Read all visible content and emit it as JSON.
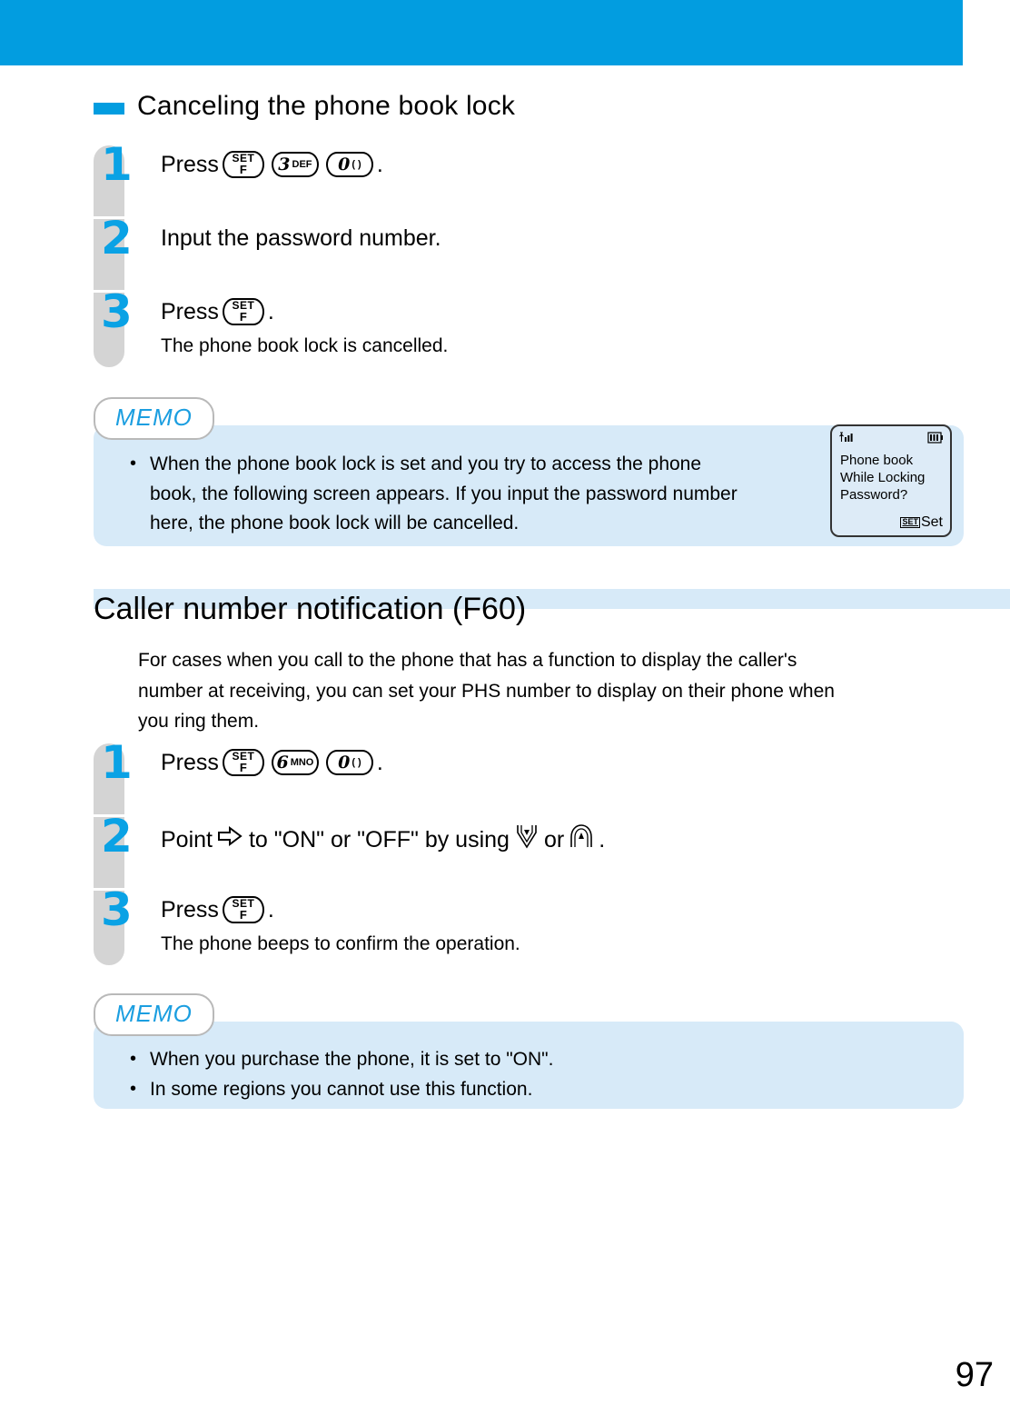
{
  "page": {
    "number": "97",
    "banner_color": "#029de0",
    "accent_color": "#0aa2e5",
    "memo_bg_color": "#d7eaf8"
  },
  "subsection": {
    "title": "Canceling the phone book lock",
    "steps": [
      {
        "number": "1",
        "text_before": "Press",
        "keys": [
          "SET/F",
          "3 DEF",
          "0 ( )"
        ],
        "text_after": ".",
        "sub": ""
      },
      {
        "number": "2",
        "text_before": "Input the password number.",
        "keys": [],
        "text_after": "",
        "sub": ""
      },
      {
        "number": "3",
        "text_before": "Press",
        "keys": [
          "SET/F"
        ],
        "text_after": ".",
        "sub": "The phone book lock is cancelled."
      }
    ]
  },
  "memo1": {
    "label": "MEMO",
    "items": [
      {
        "bullet": "•",
        "lines": [
          "When the phone book lock is set and you try to access the phone",
          "book, the following screen appears. If you input the password number",
          "here, the phone book lock will be cancelled."
        ]
      }
    ],
    "phone_screen": {
      "signal_icon": "signal-bars-icon",
      "battery_icon": "battery-icon",
      "lines": [
        "Phone book",
        "While Locking",
        "Password?"
      ],
      "softkey_icon": "set-key-icon",
      "softkey_label": "Set"
    }
  },
  "section": {
    "title": "Caller number notification (F60)",
    "paragraph": [
      "For cases when you call to the phone that has a function to display the caller's",
      "number at receiving, you can set your PHS number to display on their phone when",
      "you ring them."
    ],
    "steps": [
      {
        "number": "1",
        "text_before": "Press",
        "keys": [
          "SET/F",
          "6 MNO",
          "0 ( )"
        ],
        "text_after": ".",
        "sub": ""
      },
      {
        "number": "2",
        "text_before": "Point",
        "mid_text": "to \"ON\" or \"OFF\" by using",
        "or_text": "or",
        "text_after": ".",
        "sub": ""
      },
      {
        "number": "3",
        "text_before": "Press",
        "keys": [
          "SET/F"
        ],
        "text_after": ".",
        "sub": "The phone beeps to confirm the operation."
      }
    ]
  },
  "memo2": {
    "label": "MEMO",
    "items": [
      {
        "bullet": "•",
        "lines": [
          "When you purchase the phone, it is set to \"ON\"."
        ]
      },
      {
        "bullet": "•",
        "lines": [
          "In some regions you cannot use this function."
        ]
      }
    ]
  },
  "key_labels": {
    "set_top": "SET",
    "set_bottom": "F",
    "three_digit": "3",
    "three_sub": "DEF",
    "six_digit": "6",
    "six_sub": "MNO",
    "zero_digit": "0",
    "zero_sub": "( )"
  }
}
